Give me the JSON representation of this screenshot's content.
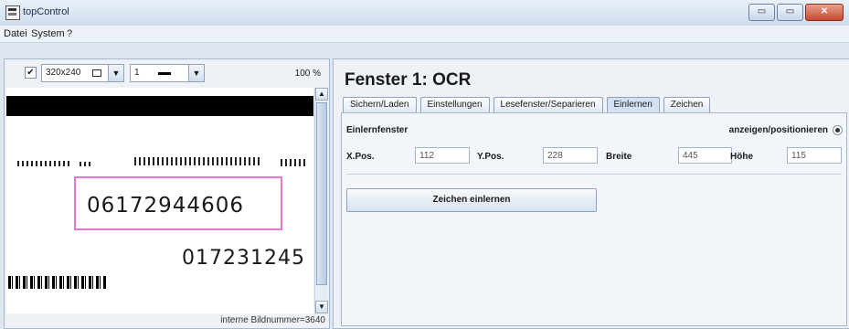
{
  "window": {
    "title": "topControl",
    "min": "▭",
    "max": "▭",
    "close": "✕"
  },
  "menu": [
    "Datei",
    "System",
    "?"
  ],
  "left": {
    "checkbox": "✔",
    "resolution": "320x240",
    "line_width": "1",
    "zoom": "100 %",
    "frame_label": "interne Bildnummer=3640",
    "ocr_text": "06172944606",
    "number2": "017231245"
  },
  "right": {
    "title": "Fenster 1: OCR",
    "tabs": [
      "Sichern/Laden",
      "Einstellungen",
      "Lesefenster/Separieren",
      "Einlernen",
      "Zeichen"
    ],
    "active_tab": "Einlernen",
    "section_label": "Einlernfenster",
    "show_position_label": "anzeigen/positionieren",
    "fields": [
      {
        "label": "X.Pos.",
        "value": "112"
      },
      {
        "label": "Y.Pos.",
        "value": "228"
      },
      {
        "label": "Breite",
        "value": "445"
      },
      {
        "label": "Höhe",
        "value": "115"
      }
    ],
    "learn_button": "Zeichen einlernen"
  },
  "colors": {
    "accent": "#d3e1f3",
    "ocr_box": "#e07ad0",
    "background": "#dfe7f1"
  }
}
